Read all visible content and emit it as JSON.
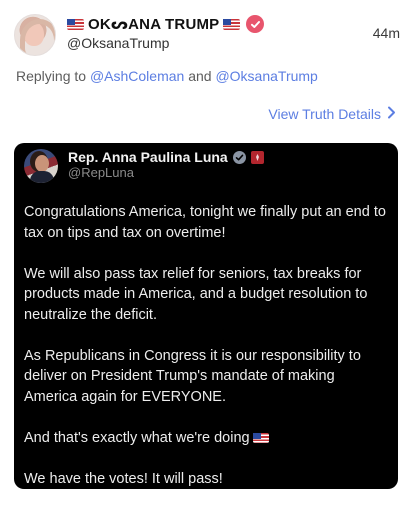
{
  "post": {
    "display_name": "OKᔕANA TRUMP",
    "handle": "@OksanaTrump",
    "timestamp": "44m",
    "replying_prefix": "Replying to",
    "replying_user1": "@AshColeman",
    "replying_and": "and",
    "replying_user2": "@OksanaTrump",
    "view_details": "View Truth Details"
  },
  "quote": {
    "display_name": "Rep. Anna Paulina Luna",
    "handle": "@RepLuna",
    "paragraphs": [
      "Congratulations America, tonight we finally put an end to tax on tips and tax on overtime!",
      "We will also pass tax relief for seniors, tax breaks for products made in America, and a budget resolution to neutralize the deficit.",
      "As Republicans in Congress it is our responsibility to deliver on President Trump's mandate of making America again for EVERYONE.",
      "And that's exactly what we're doing",
      "We have the votes! It will pass!"
    ]
  },
  "colors": {
    "link": "#5c7ee2",
    "verified_badge": "#e8556d",
    "card_bg": "#000000"
  },
  "icons": {
    "flag": "us-flag-icon",
    "verified": "verified-badge-icon",
    "chevron": "chevron-right-icon"
  }
}
